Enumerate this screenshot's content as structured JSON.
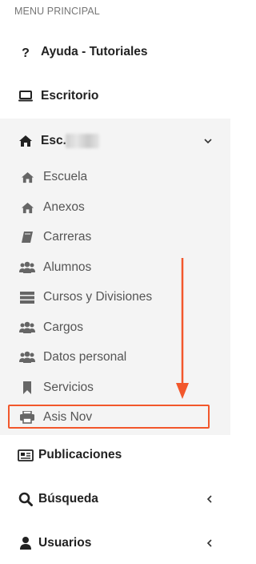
{
  "menu": {
    "header": "MENU PRINCIPAL",
    "items": [
      {
        "label": "Ayuda - Tutoriales",
        "icon": "question-icon"
      },
      {
        "label": "Escritorio",
        "icon": "laptop-icon"
      },
      {
        "label": "Esc.",
        "icon": "home-icon",
        "expanded": true
      }
    ],
    "submenu": [
      {
        "label": "Escuela",
        "icon": "home-icon"
      },
      {
        "label": "Anexos",
        "icon": "home-icon"
      },
      {
        "label": "Carreras",
        "icon": "book-icon"
      },
      {
        "label": "Alumnos",
        "icon": "users-icon"
      },
      {
        "label": "Cursos y Divisiones",
        "icon": "server-icon"
      },
      {
        "label": "Cargos",
        "icon": "users-icon"
      },
      {
        "label": "Datos personal",
        "icon": "users-icon"
      },
      {
        "label": "Servicios",
        "icon": "bookmark-icon"
      },
      {
        "label": "Asis Nov",
        "icon": "print-icon",
        "highlighted": true
      }
    ],
    "bottom": [
      {
        "label": "Publicaciones",
        "icon": "newspaper-icon"
      },
      {
        "label": "Búsqueda",
        "icon": "search-icon"
      },
      {
        "label": "Usuarios",
        "icon": "user-icon"
      }
    ]
  },
  "colors": {
    "annotation": "#f2572b",
    "section_bg": "#f4f4f4",
    "header_text": "#767676"
  }
}
